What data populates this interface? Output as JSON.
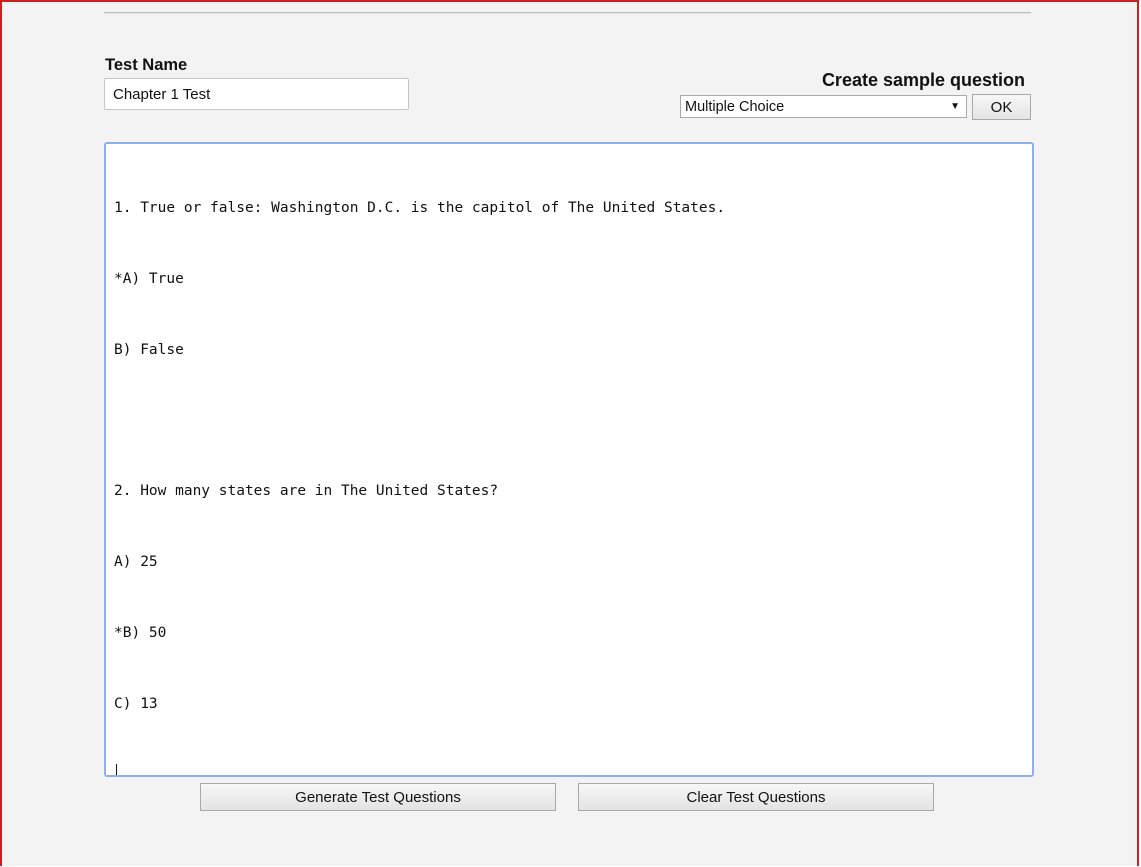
{
  "form": {
    "test_name_label": "Test Name",
    "test_name_value": "Chapter 1 Test",
    "sample_question_label": "Create sample question",
    "question_type_selected": "Multiple Choice",
    "ok_label": "OK"
  },
  "editor": {
    "lines": [
      "1. True or false: Washington D.C. is the capitol of The United States.",
      "*A) True",
      "B) False",
      "",
      "2. How many states are in The United States?",
      "A) 25",
      "*B) 50",
      "C) 13"
    ]
  },
  "actions": {
    "generate_label": "Generate Test Questions",
    "clear_label": "Clear Test Questions"
  },
  "colors": {
    "frame_border": "#cc1f1f",
    "page_background": "#f3f3f3",
    "editor_focus_border": "#8fb0e6"
  },
  "icons": {
    "select_caret": "triangle-down-icon"
  }
}
